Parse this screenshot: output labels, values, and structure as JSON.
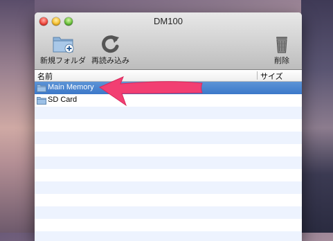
{
  "window": {
    "title": "DM100"
  },
  "toolbar": {
    "new_folder_label": "新規フォルダ",
    "reload_label": "再読み込み",
    "delete_label": "削除"
  },
  "columns": {
    "name": "名前",
    "size": "サイズ"
  },
  "files": [
    {
      "name": "Main Memory",
      "selected": true
    },
    {
      "name": "SD Card",
      "selected": false
    }
  ],
  "colors": {
    "selection": "#3b78c9",
    "alternate_row": "#edf3fe",
    "annotation_arrow": "#f23f72"
  }
}
